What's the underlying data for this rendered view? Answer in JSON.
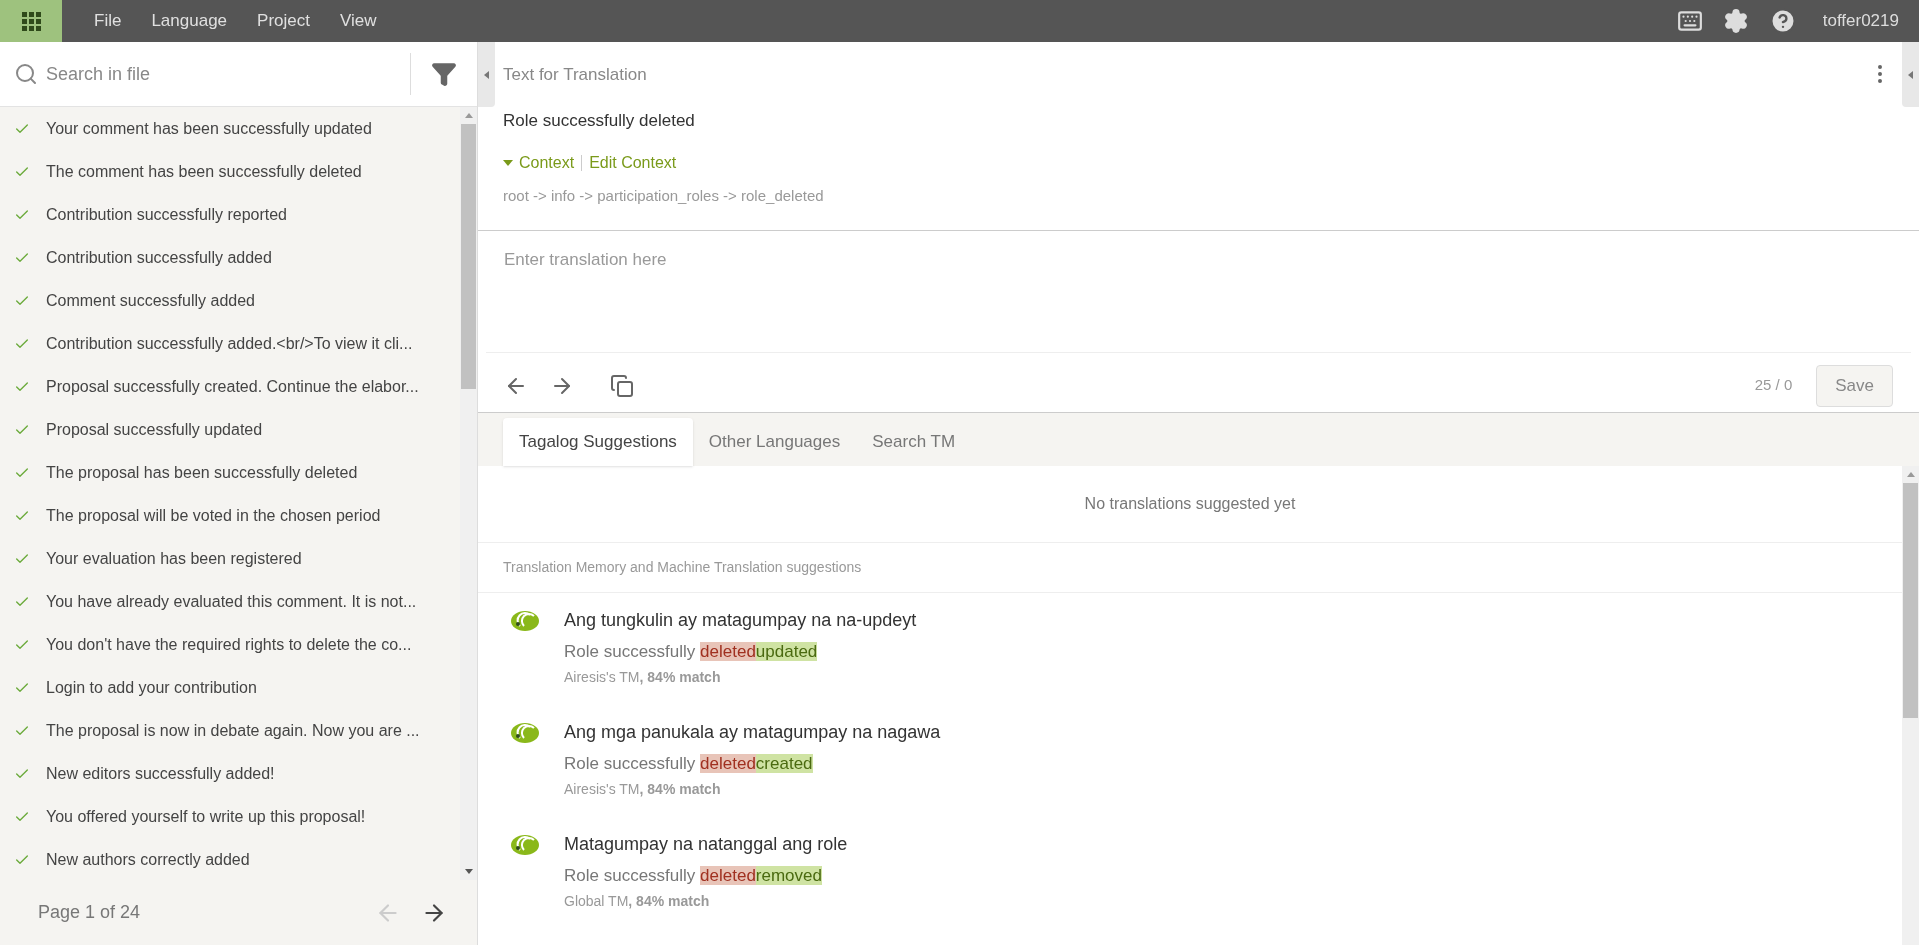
{
  "menu": {
    "items": [
      "File",
      "Language",
      "Project",
      "View"
    ],
    "user": "toffer0219"
  },
  "sidebar": {
    "search": {
      "placeholder": "Search in file"
    },
    "items": [
      {
        "text": "Your comment has been successfully updated",
        "translated": true
      },
      {
        "text": "The comment has been successfully deleted",
        "translated": true
      },
      {
        "text": "Contribution successfully reported",
        "translated": true
      },
      {
        "text": "Contribution successfully added",
        "translated": true
      },
      {
        "text": "Comment successfully added",
        "translated": true
      },
      {
        "text": "Contribution successfully added.<br/>To view it cli...",
        "translated": true
      },
      {
        "text": "Proposal successfully created. Continue the elabor...",
        "translated": true
      },
      {
        "text": "Proposal successfully updated",
        "translated": true
      },
      {
        "text": "The proposal has been successfully deleted",
        "translated": true
      },
      {
        "text": "The proposal will be voted in the chosen period",
        "translated": true
      },
      {
        "text": "Your evaluation has been registered",
        "translated": true
      },
      {
        "text": "You have already evaluated this comment. It is not...",
        "translated": true
      },
      {
        "text": "You don't have the required rights to delete the co...",
        "translated": true
      },
      {
        "text": "Login to add your contribution",
        "translated": true
      },
      {
        "text": "The proposal is now in debate again. Now you are ...",
        "translated": true
      },
      {
        "text": "New editors successfully added!",
        "translated": true
      },
      {
        "text": "You offered yourself to write up this proposal!",
        "translated": true
      },
      {
        "text": "New authors correctly added",
        "translated": true
      }
    ],
    "pager": {
      "label": "Page 1 of 24",
      "prev_disabled": true,
      "next_disabled": false
    }
  },
  "source": {
    "heading": "Text for Translation",
    "text": "Role successfully deleted",
    "context_label": "Context",
    "context_expanded": true,
    "edit_context": "Edit Context",
    "path": "root -> info -> participation_roles -> role_deleted"
  },
  "editor": {
    "placeholder": "Enter translation here",
    "counter": "25 / 0",
    "save": "Save"
  },
  "tabs": [
    {
      "label": "Tagalog Suggestions",
      "selected": true
    },
    {
      "label": "Other Languages",
      "selected": false
    },
    {
      "label": "Search TM",
      "selected": false
    }
  ],
  "suggestions": {
    "empty": "No translations suggested yet",
    "tm_heading": "Translation Memory and Machine Translation suggestions",
    "items": [
      {
        "translation": "Ang tungkulin ay matagumpay na na-updeyt",
        "source": [
          {
            "kind": "same",
            "text": "Role successfully "
          },
          {
            "kind": "removed",
            "text": "deleted"
          },
          {
            "kind": "added",
            "text": "updated"
          }
        ],
        "origin": "Airesis's TM**, 84% match**"
      },
      {
        "translation": "Ang mga panukala ay matagumpay na nagawa",
        "source": [
          {
            "kind": "same",
            "text": "Role successfully "
          },
          {
            "kind": "removed",
            "text": "deleted"
          },
          {
            "kind": "added",
            "text": "created"
          }
        ],
        "origin": "Airesis's TM**, 84% match**"
      },
      {
        "translation": "Matagumpay na natanggal ang role",
        "source": [
          {
            "kind": "same",
            "text": "Role successfully "
          },
          {
            "kind": "removed",
            "text": "deleted"
          },
          {
            "kind": "added",
            "text": "removed"
          }
        ],
        "origin": "Global TM**, 84% match**"
      }
    ]
  }
}
